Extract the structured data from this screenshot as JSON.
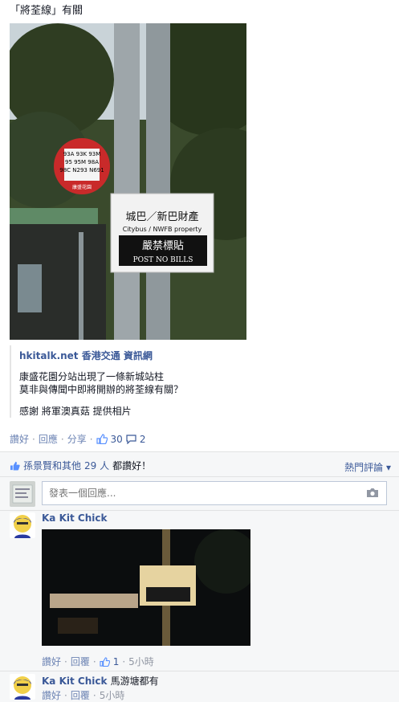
{
  "post": {
    "text": "「將荃線」有關",
    "link_title": "hkitalk.net 香港交通 資訊網",
    "link_desc_line1": "康盛花園分站出現了一條新城站柱",
    "link_desc_line2": "莫非與傳聞中即將開辦的將荃線有關？",
    "link_credit": "感謝 將軍澳真菇 提供相片",
    "photo_sign": {
      "line1": "城巴／新巴財產",
      "line2": "Citybus / NWFB property",
      "line3": "嚴禁標貼",
      "line4": "POST NO BILLS",
      "busstop_routes": [
        "93A",
        "93K",
        "93M",
        "95",
        "95M",
        "98A",
        "98C",
        "N293",
        "N691"
      ],
      "busstop_name": "康盛花園"
    }
  },
  "actions": {
    "like": "讚好",
    "comment": "回應",
    "share": "分享",
    "like_count": "30",
    "comment_count": "2"
  },
  "ufi": {
    "likes_names": "孫景賢和其他",
    "likes_count": "29 人",
    "likes_suffix": "都讚好！",
    "sort_label": "熱門評論",
    "comment_placeholder": "發表一個回應..."
  },
  "comments": [
    {
      "author": "Ka Kit Chick",
      "text": "",
      "like": "讚好",
      "reply": "回覆",
      "likes": "1",
      "time": "5小時"
    },
    {
      "author": "Ka Kit Chick",
      "text": "馬游塘都有",
      "like": "讚好",
      "reply": "回覆",
      "time": "5小時"
    }
  ],
  "colors": {
    "link": "#3b5998",
    "action": "#6d84b4",
    "muted": "#9197a3",
    "bg": "#f6f7f8"
  }
}
